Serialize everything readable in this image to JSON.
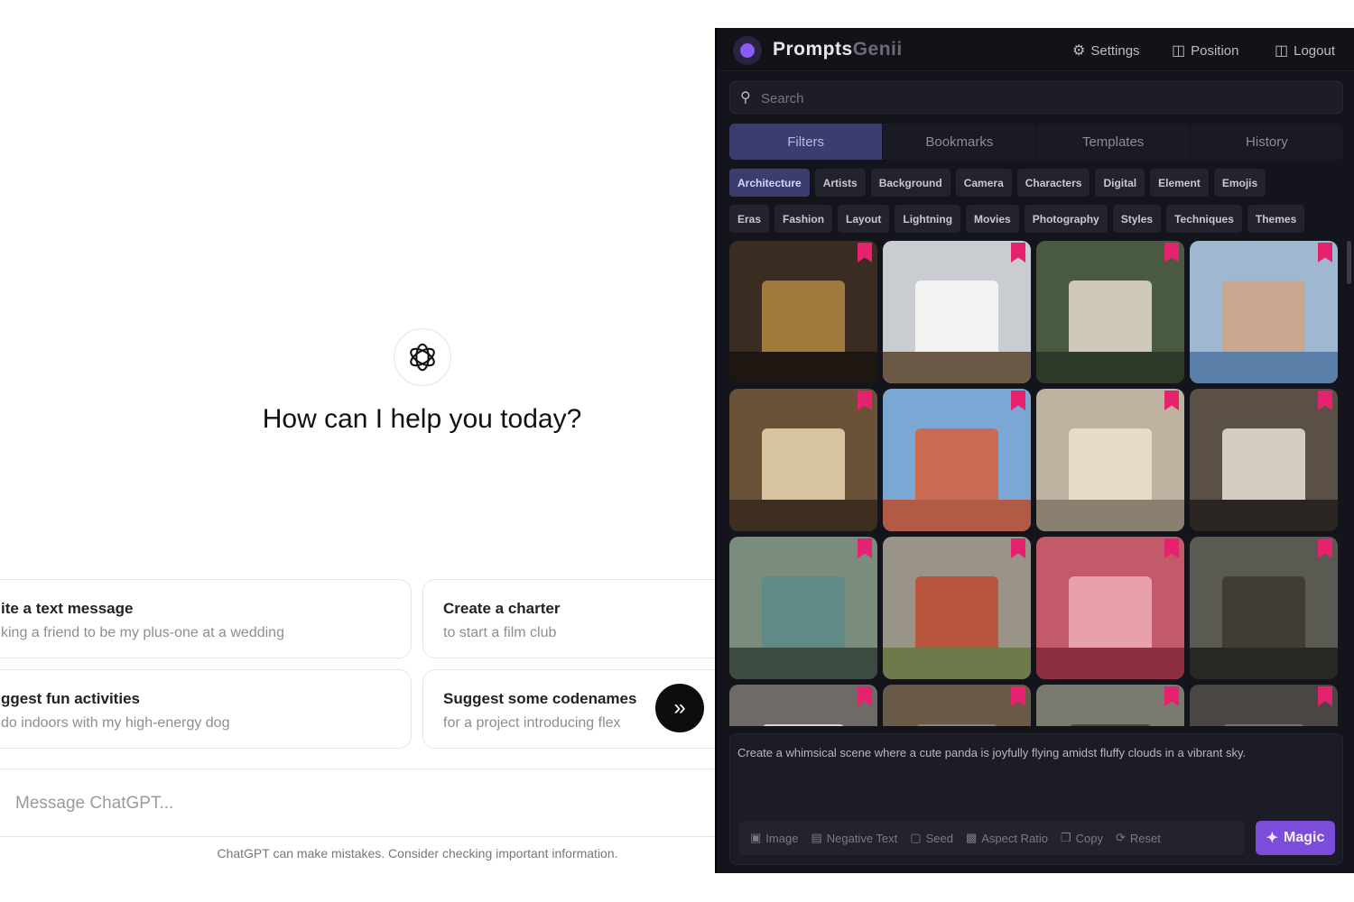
{
  "chatgpt": {
    "headline": "How can I help you today?",
    "suggestions": [
      {
        "title": "ite a text message",
        "subtitle": "king a friend to be my plus-one at a wedding"
      },
      {
        "title": "Create a charter",
        "subtitle": "to start a film club"
      },
      {
        "title": "ggest fun activities",
        "subtitle": "do indoors with my high-energy dog"
      },
      {
        "title": "Suggest some codenames",
        "subtitle": "for a project introducing flex"
      }
    ],
    "message_placeholder": "Message ChatGPT...",
    "disclaimer": "ChatGPT can make mistakes. Consider checking important information."
  },
  "panel": {
    "brand_primary": "Prompts",
    "brand_secondary": "Genii",
    "actions": {
      "settings": "Settings",
      "position": "Position",
      "logout": "Logout"
    },
    "search_placeholder": "Search",
    "tabs": [
      "Filters",
      "Bookmarks",
      "Templates",
      "History"
    ],
    "active_tab": "Filters",
    "chips_row1": [
      "Architecture",
      "Artists",
      "Background",
      "Camera",
      "Characters",
      "Digital",
      "Element",
      "Emojis"
    ],
    "chips_row2": [
      "Eras",
      "Fashion",
      "Layout",
      "Lightning",
      "Movies",
      "Photography",
      "Styles",
      "Techniques",
      "Themes"
    ],
    "active_chip": "Architecture",
    "tiles": [
      {
        "bg": "#3a2c20",
        "a": "#a07a3c",
        "b": "#1e1610"
      },
      {
        "bg": "#c9cdd2",
        "a": "#f2f2f2",
        "b": "#6a5a45"
      },
      {
        "bg": "#4a5a40",
        "a": "#cfc8b8",
        "b": "#2e3a28"
      },
      {
        "bg": "#9fb8cf",
        "a": "#c8a890",
        "b": "#5a7fa8"
      },
      {
        "bg": "#6a5238",
        "a": "#d8c4a0",
        "b": "#3e2e20"
      },
      {
        "bg": "#7aa7d4",
        "a": "#c96a52",
        "b": "#b25a44"
      },
      {
        "bg": "#bdb3a0",
        "a": "#e6dcc8",
        "b": "#8a8070"
      },
      {
        "bg": "#5a5048",
        "a": "#d2ccc2",
        "b": "#2c2622"
      },
      {
        "bg": "#7a8c7e",
        "a": "#5f8a86",
        "b": "#3c4a40"
      },
      {
        "bg": "#9a9488",
        "a": "#b8563e",
        "b": "#6e7a4a"
      },
      {
        "bg": "#c25a6a",
        "a": "#e8a0aa",
        "b": "#8c2e40"
      },
      {
        "bg": "#5a5a52",
        "a": "#403c36",
        "b": "#2a2824"
      },
      {
        "bg": "#6e6a66",
        "a": "#d8d4cc",
        "b": "#3c3834"
      },
      {
        "bg": "#6a5a4a",
        "a": "#8a8478",
        "b": "#3a3028"
      },
      {
        "bg": "#7a7a70",
        "a": "#4a4a42",
        "b": "#2e2e28"
      },
      {
        "bg": "#4a4644",
        "a": "#7a7068",
        "b": "#2a2624"
      }
    ],
    "prompt_text": "Create a whimsical scene where a cute panda is joyfully flying amidst fluffy clouds in a vibrant sky.",
    "tools": [
      "Image",
      "Negative Text",
      "Seed",
      "Aspect Ratio",
      "Copy",
      "Reset"
    ],
    "magic_label": "Magic",
    "colors": {
      "accent": "#7c4ddb",
      "active_tab": "#3a3d6e",
      "bookmark": "#e6226e"
    }
  }
}
